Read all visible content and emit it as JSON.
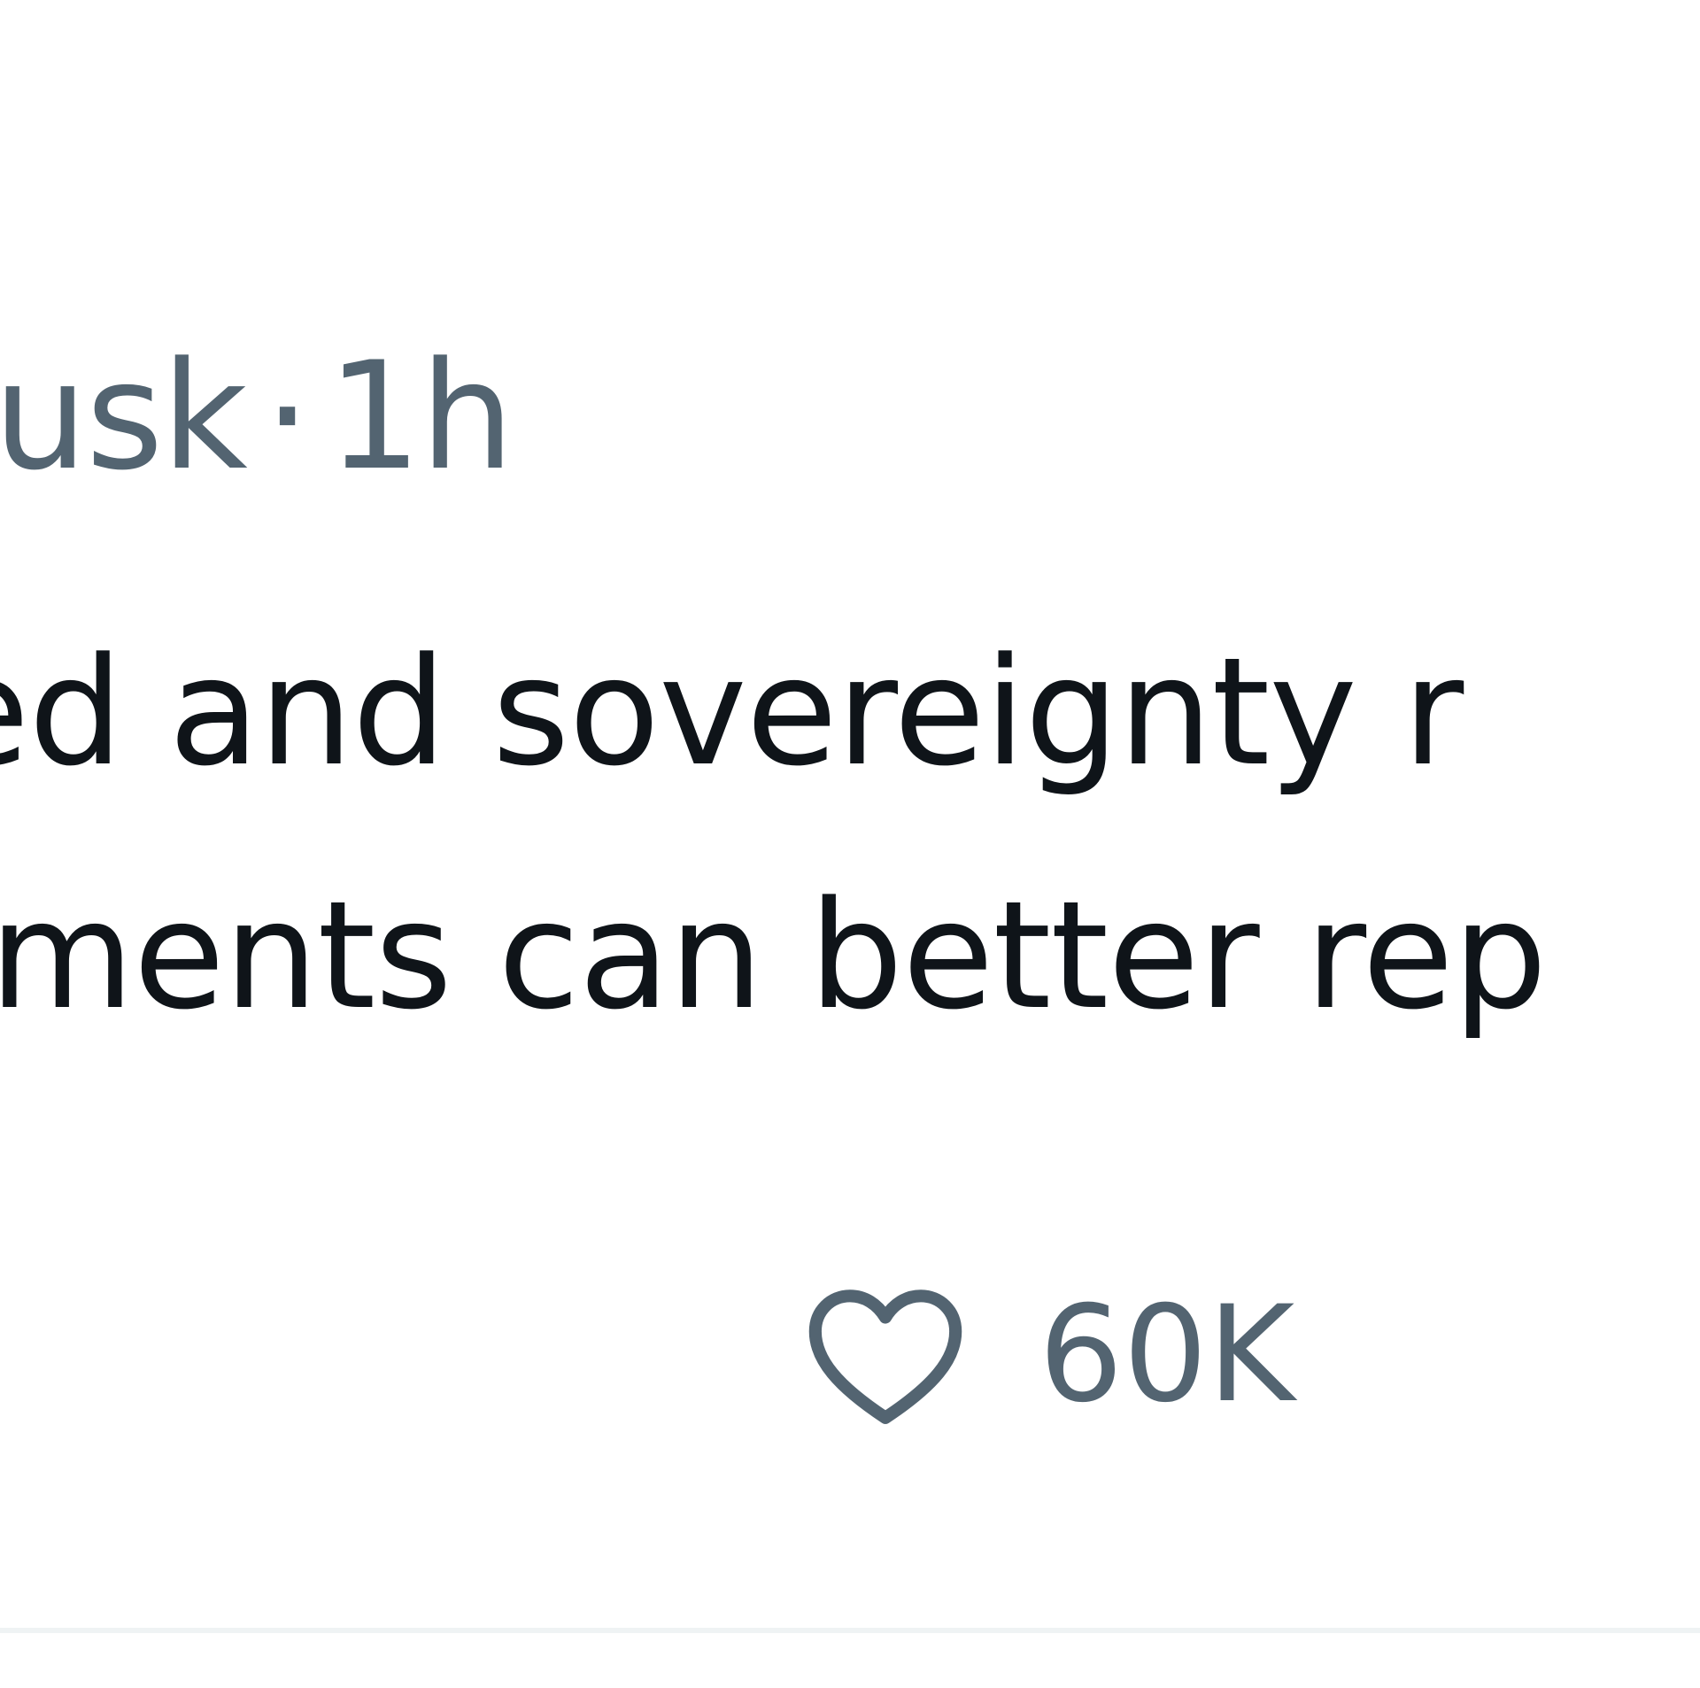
{
  "tweet": {
    "handle_fragment": "nusk",
    "separator": "·",
    "timestamp": "1h",
    "text_lines": [
      "ed and sovereignty r",
      "ments can better rep"
    ],
    "actions": {
      "like": {
        "icon": "heart-icon",
        "count": "60K"
      }
    }
  },
  "colors": {
    "text_primary": "#0f1419",
    "text_secondary": "#536471",
    "divider": "#eff3f4"
  }
}
